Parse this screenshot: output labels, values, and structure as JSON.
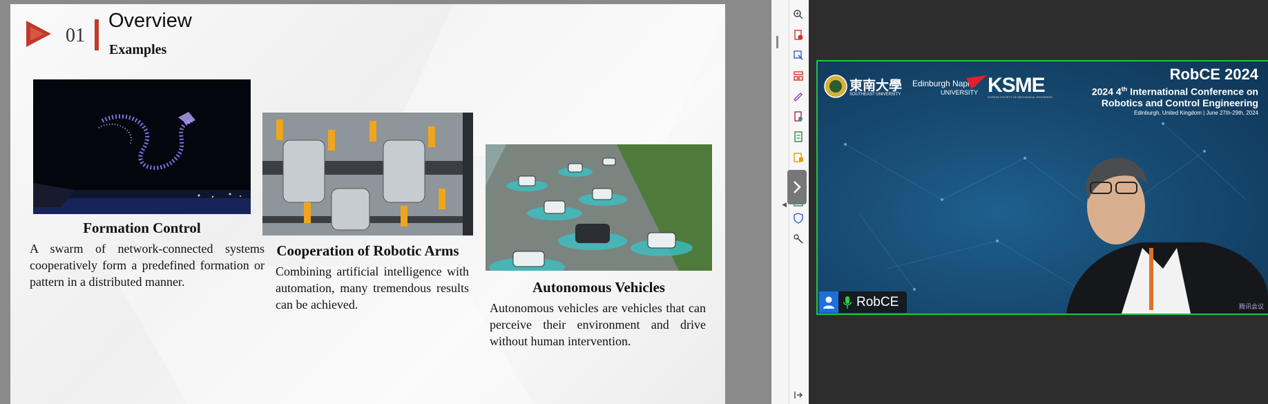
{
  "slide": {
    "section_number": "01",
    "title": "Overview",
    "subtitle": "Examples",
    "items": [
      {
        "caption": "Formation Control",
        "text": "A swarm of network-connected systems cooperatively form a predefined formation or pattern in a distributed manner."
      },
      {
        "caption": "Cooperation of Robotic Arms",
        "text": "Combining artificial intelligence with automation, many tremendous results can be achieved."
      },
      {
        "caption": "Autonomous Vehicles",
        "text": "Autonomous vehicles are vehicles that can perceive their environment and drive without human intervention."
      }
    ]
  },
  "video": {
    "participant_name": "RobCE",
    "conference_short": "RobCE 2024",
    "conference_line1_prefix": "2024 4",
    "conference_line1_sup": "th",
    "conference_line1_suffix": " International Conference on",
    "conference_line2": "Robotics and Control Engineering",
    "conference_location": "Edinburgh, United Kingdom | June 27th-29th, 2024",
    "logo_university_cn": "東南大學",
    "logo_university_en": "SOUTHEAST UNIVERSITY",
    "logo_napier_1": "Edinburgh Napier",
    "logo_napier_2": "UNIVERSITY",
    "logo_ksme": "KSME",
    "logo_ksme_sub": "KOREAN SOCIETY OF MECHANICAL ENGINEERS",
    "watermark": "腾讯会议"
  },
  "colors": {
    "accent_red": "#c0392b",
    "active_speaker_border": "#1fc44b",
    "name_avatar": "#1e6fd9"
  },
  "toolbar_icons": [
    "zoom-in-icon",
    "pdf-remove-icon",
    "export-icon",
    "organize-pages-icon",
    "sign-icon",
    "compress-icon",
    "excel-icon",
    "comment-icon",
    "note-icon",
    "scan-icon",
    "protect-icon",
    "tools-icon",
    "collapse-panel-icon"
  ]
}
